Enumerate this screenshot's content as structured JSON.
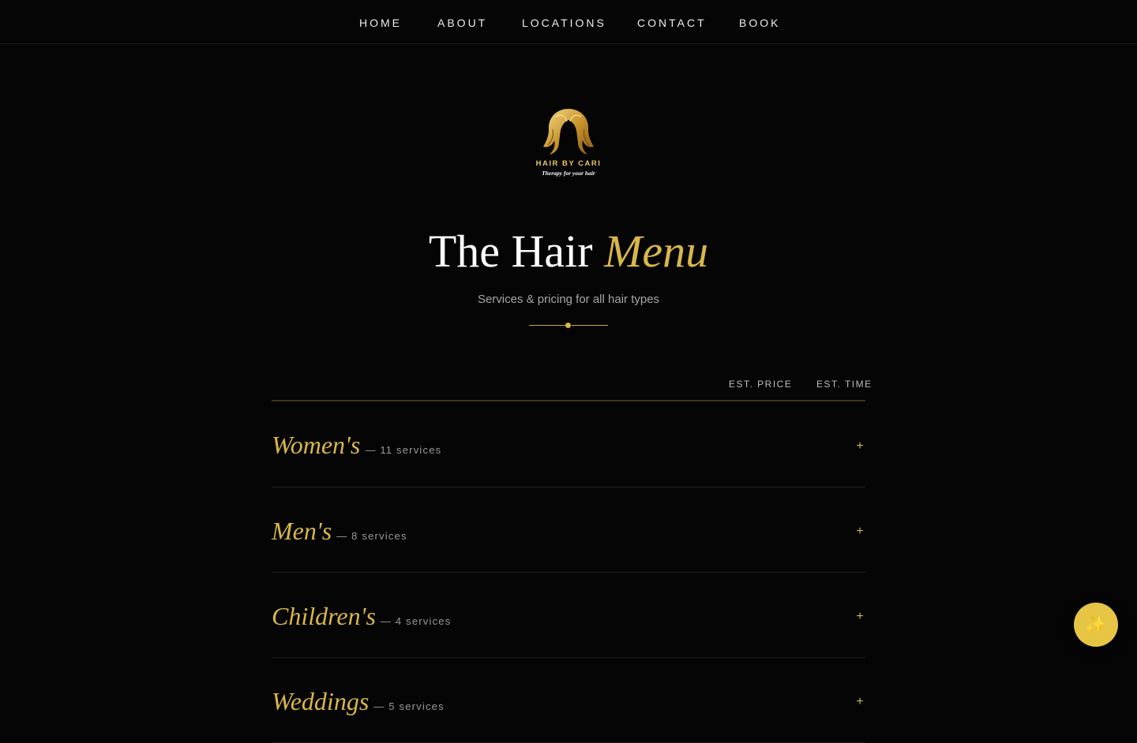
{
  "nav": {
    "items": [
      "HOME",
      "ABOUT",
      "LOCATIONS",
      "CONTACT",
      "BOOK"
    ]
  },
  "logo": {
    "name": "HAIR BY CARI",
    "tagline": "Therapy for your hair"
  },
  "hero": {
    "title_main": "The Hair",
    "title_accent": "Menu",
    "subtitle": "Services & pricing for all hair types"
  },
  "table": {
    "col_price": "EST. PRICE",
    "col_time": "EST. TIME",
    "categories": [
      {
        "name": "Women's",
        "count": "— 11 services"
      },
      {
        "name": "Men's",
        "count": "— 8 services"
      },
      {
        "name": "Children's",
        "count": "— 4 services"
      },
      {
        "name": "Weddings",
        "count": "— 5 services"
      }
    ],
    "expand_symbol": "+"
  },
  "fab": {
    "icon": "sparkles-icon",
    "glyph": "✨"
  },
  "colors": {
    "background": "#050506",
    "gold": "#d8b64a",
    "fab": "#e6c545"
  }
}
